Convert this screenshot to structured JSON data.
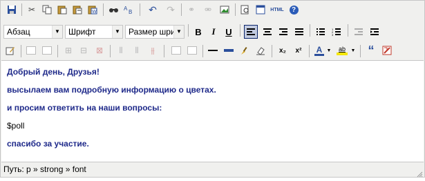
{
  "toolbar": {
    "format_select": "Абзац",
    "font_select": "Шрифт",
    "size_select": "Размер шри",
    "bold_label": "B",
    "italic_label": "I",
    "underline_label": "U",
    "subscript_label": "x₂",
    "superscript_label": "x²",
    "html_label": "HTML",
    "help_label": "?",
    "text_color_label": "A",
    "highlight_label": "ab",
    "quote_label": "“"
  },
  "content": {
    "lines": [
      "Добрый день,  Друзья!",
      "высылаем вам подробную информацию о цветах.",
      "и просим ответить на наши вопросы:",
      "$poll",
      "спасибо за участие."
    ]
  },
  "status": {
    "path": "Путь: p » strong » font"
  }
}
